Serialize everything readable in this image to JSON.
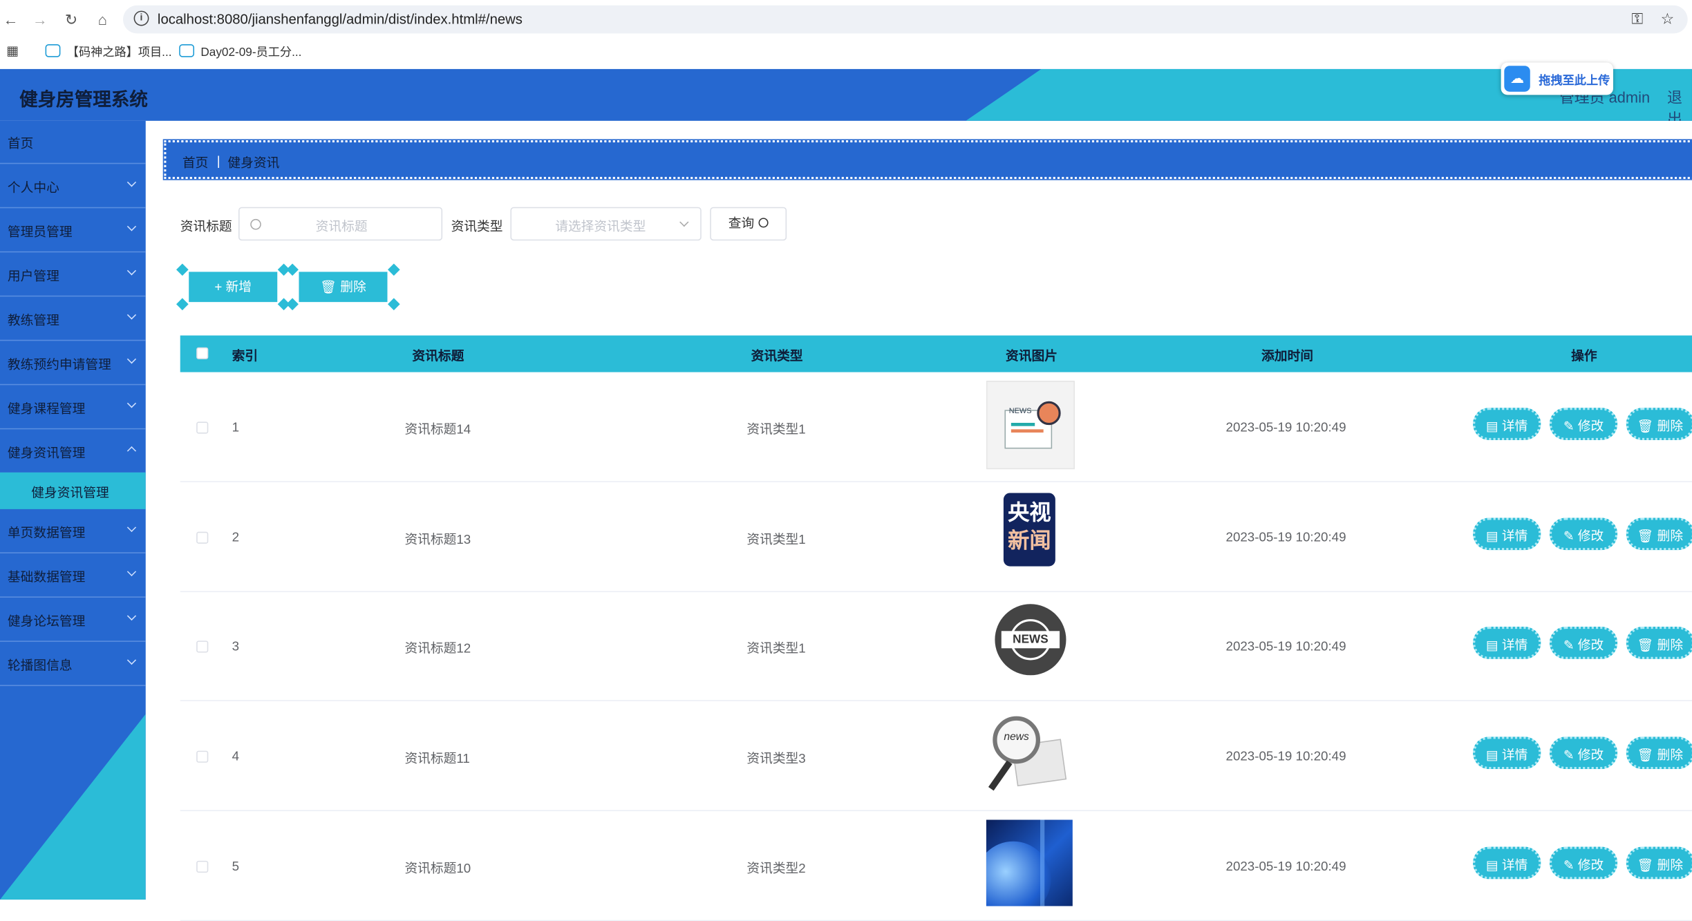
{
  "browser": {
    "url": "localhost:8080/jianshenfanggl/admin/dist/index.html#/news",
    "bookmarks": [
      "【码神之路】项目...",
      "Day02-09-员工分..."
    ]
  },
  "header": {
    "title": "健身房管理系统",
    "user": "管理员 admin",
    "logout": "退出",
    "upload_popup": "拖拽至此上传"
  },
  "sidebar": {
    "items": [
      {
        "label": "首页",
        "has_chevron": false
      },
      {
        "label": "个人中心",
        "has_chevron": true
      },
      {
        "label": "管理员管理",
        "has_chevron": true
      },
      {
        "label": "用户管理",
        "has_chevron": true
      },
      {
        "label": "教练管理",
        "has_chevron": true
      },
      {
        "label": "教练预约申请管理",
        "has_chevron": true
      },
      {
        "label": "健身课程管理",
        "has_chevron": true
      },
      {
        "label": "健身资讯管理",
        "has_chevron": true
      }
    ],
    "active_sub": "健身资讯管理",
    "items_after": [
      {
        "label": "单页数据管理"
      },
      {
        "label": "基础数据管理"
      },
      {
        "label": "健身论坛管理"
      },
      {
        "label": "轮播图信息"
      }
    ]
  },
  "breadcrumb": {
    "home": "首页",
    "separator": "|",
    "current": "健身资讯"
  },
  "search": {
    "title_label": "资讯标题",
    "title_placeholder": "资讯标题",
    "type_label": "资讯类型",
    "type_placeholder": "请选择资讯类型",
    "query_button": "查询"
  },
  "actions": {
    "add": "+ 新增",
    "delete": "删除"
  },
  "table": {
    "columns": [
      "索引",
      "资讯标题",
      "资讯类型",
      "资讯图片",
      "添加时间",
      "操作"
    ],
    "rows": [
      {
        "index": "1",
        "title": "资讯标题14",
        "type": "资讯类型1",
        "image": "news-paper-image",
        "time": "2023-05-19 10:20:49"
      },
      {
        "index": "2",
        "title": "资讯标题13",
        "type": "资讯类型1",
        "image": "cctv-news-logo",
        "time": "2023-05-19 10:20:49"
      },
      {
        "index": "3",
        "title": "资讯标题12",
        "type": "资讯类型1",
        "image": "news-globe-icon",
        "time": "2023-05-19 10:20:49"
      },
      {
        "index": "4",
        "title": "资讯标题11",
        "type": "资讯类型3",
        "image": "news-magnifier-image",
        "time": "2023-05-19 10:20:49"
      },
      {
        "index": "5",
        "title": "资讯标题10",
        "type": "资讯类型2",
        "image": "blue-globe-image",
        "time": "2023-05-19 10:20:49"
      }
    ],
    "row_actions": [
      "详情",
      "修改",
      "删除"
    ],
    "cctv_logo_text": [
      "央视",
      "新闻"
    ],
    "news_badge_text": "NEWS",
    "news_paper_text": "news"
  },
  "colors": {
    "primary_blue": "#2668d0",
    "accent_cyan": "#2bbcd7"
  }
}
